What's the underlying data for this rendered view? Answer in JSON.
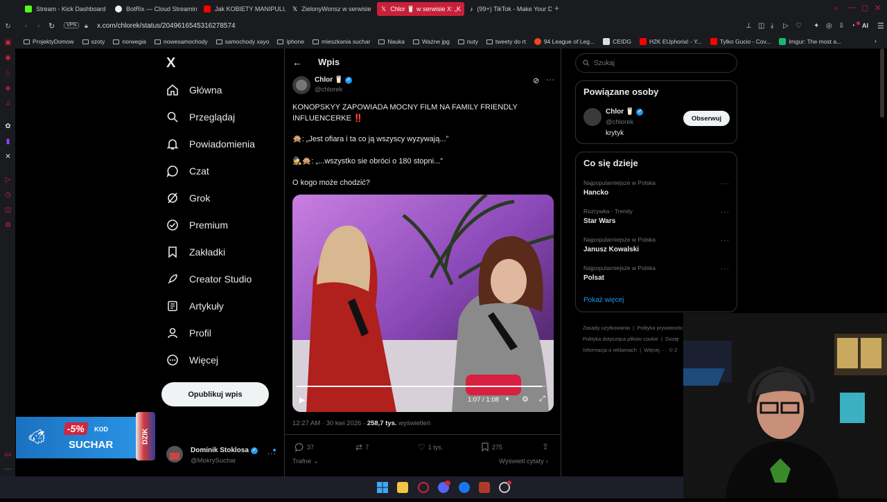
{
  "browser": {
    "tabs": [
      {
        "label": "Stream - Kick Dashboard",
        "color": "#53fc18"
      },
      {
        "label": "BotRix — Cloud Streaming",
        "color": "#ffffff"
      },
      {
        "label": "Jak KOBIETY MANIPULU...",
        "color": "#ff0000"
      },
      {
        "label": "ZielonyWonsz w serwisie",
        "color": "#ffffff"
      },
      {
        "label": "Chlor 🥛 w serwisie X: „K",
        "color": "#ffffff"
      },
      {
        "label": "(99+) TikTok - Make Your D",
        "color": "#ffffff"
      }
    ],
    "new_tab": "+",
    "vpn": "VPN",
    "url": "x.com/chlorek/status/2049616545316278574",
    "ai_label": "AI",
    "bookmarks": [
      "ProjektyDomow",
      "szoty",
      "norwegia",
      "nowesamochody",
      "samochody xayo",
      "iphone",
      "mieszkania suchar",
      "Nauka",
      "Ważne jpg",
      "nuty",
      "tweety do rt",
      "94 League of Leg...",
      "CEIDG",
      "H2K EUphoria! - Y...",
      "Tylko Gucio - Cov...",
      "Imgur: The most a..."
    ]
  },
  "sidebar": {
    "logo": "X",
    "items": [
      "Główna",
      "Przeglądaj",
      "Powiadomienia",
      "Czat",
      "Grok",
      "Premium",
      "Zakładki",
      "Creator Studio",
      "Artykuły",
      "Profil",
      "Więcej"
    ],
    "post_button": "Opublikuj wpis",
    "account": {
      "name": "Dominik Stoklosa",
      "handle": "@MokrySuchar"
    }
  },
  "post": {
    "header_title": "Wpis",
    "author": "Chlor 🥛",
    "handle": "@chlorek",
    "line1": "KONOPSKYY ZAPOWIADA MOCNY FILM NA FAMILY FRIENDLY",
    "line2": "INFLUENCERKE ‼️",
    "quote1": "🙊: „Jest ofiara i ta co ją wszyscy wyzywają...”",
    "quote2": "🕵️🙊: „...wszystko sie obróci o 180 stopni...”",
    "question": "O kogo może chodzić?",
    "video_time": "1:07 / 1:08",
    "video_progress": 0.985,
    "timestamp": "12:27 AM · 30 kwi 2026 · ",
    "views_count": "258,7 tys.",
    "views_label": " wyświetleń",
    "stats": {
      "replies": "37",
      "reposts": "7",
      "likes": "1 tys.",
      "bookmarks": "275"
    },
    "sort_label": "Trafne",
    "quotes_link": "Wyświetl cytaty"
  },
  "right": {
    "search_placeholder": "Szukaj",
    "related_title": "Powiązane osoby",
    "related": {
      "name": "Chlor 🥛",
      "handle": "@chlorek",
      "bio": "krytyk",
      "follow": "Obserwuj"
    },
    "trends_title": "Co się dzieje",
    "trends": [
      {
        "meta": "Najpopularniejsze w Polska",
        "name": "Hancko"
      },
      {
        "meta": "Rozrywka · Trendy",
        "name": "Star Wars"
      },
      {
        "meta": "Najpopularniejsze w Polska",
        "name": "Janusz Kowalski"
      },
      {
        "meta": "Najpopularniejsze w Polska",
        "name": "Polsat"
      }
    ],
    "show_more": "Pokaż więcej",
    "footer": [
      "Zasady użytkowania",
      "Polityka prywatności",
      "Polityka dotycząca plików cookie",
      "Dostę",
      "Informacja o reklamach",
      "Więcej ···",
      "© 2"
    ]
  },
  "overlay": {
    "discount": "-5%",
    "code_label": "KOD",
    "code": "SUCHAR",
    "can_text": "DZIK"
  },
  "colors": {
    "accent": "#1d9bf0",
    "opera": "#d3233b",
    "active_tab": "#c8203a"
  }
}
